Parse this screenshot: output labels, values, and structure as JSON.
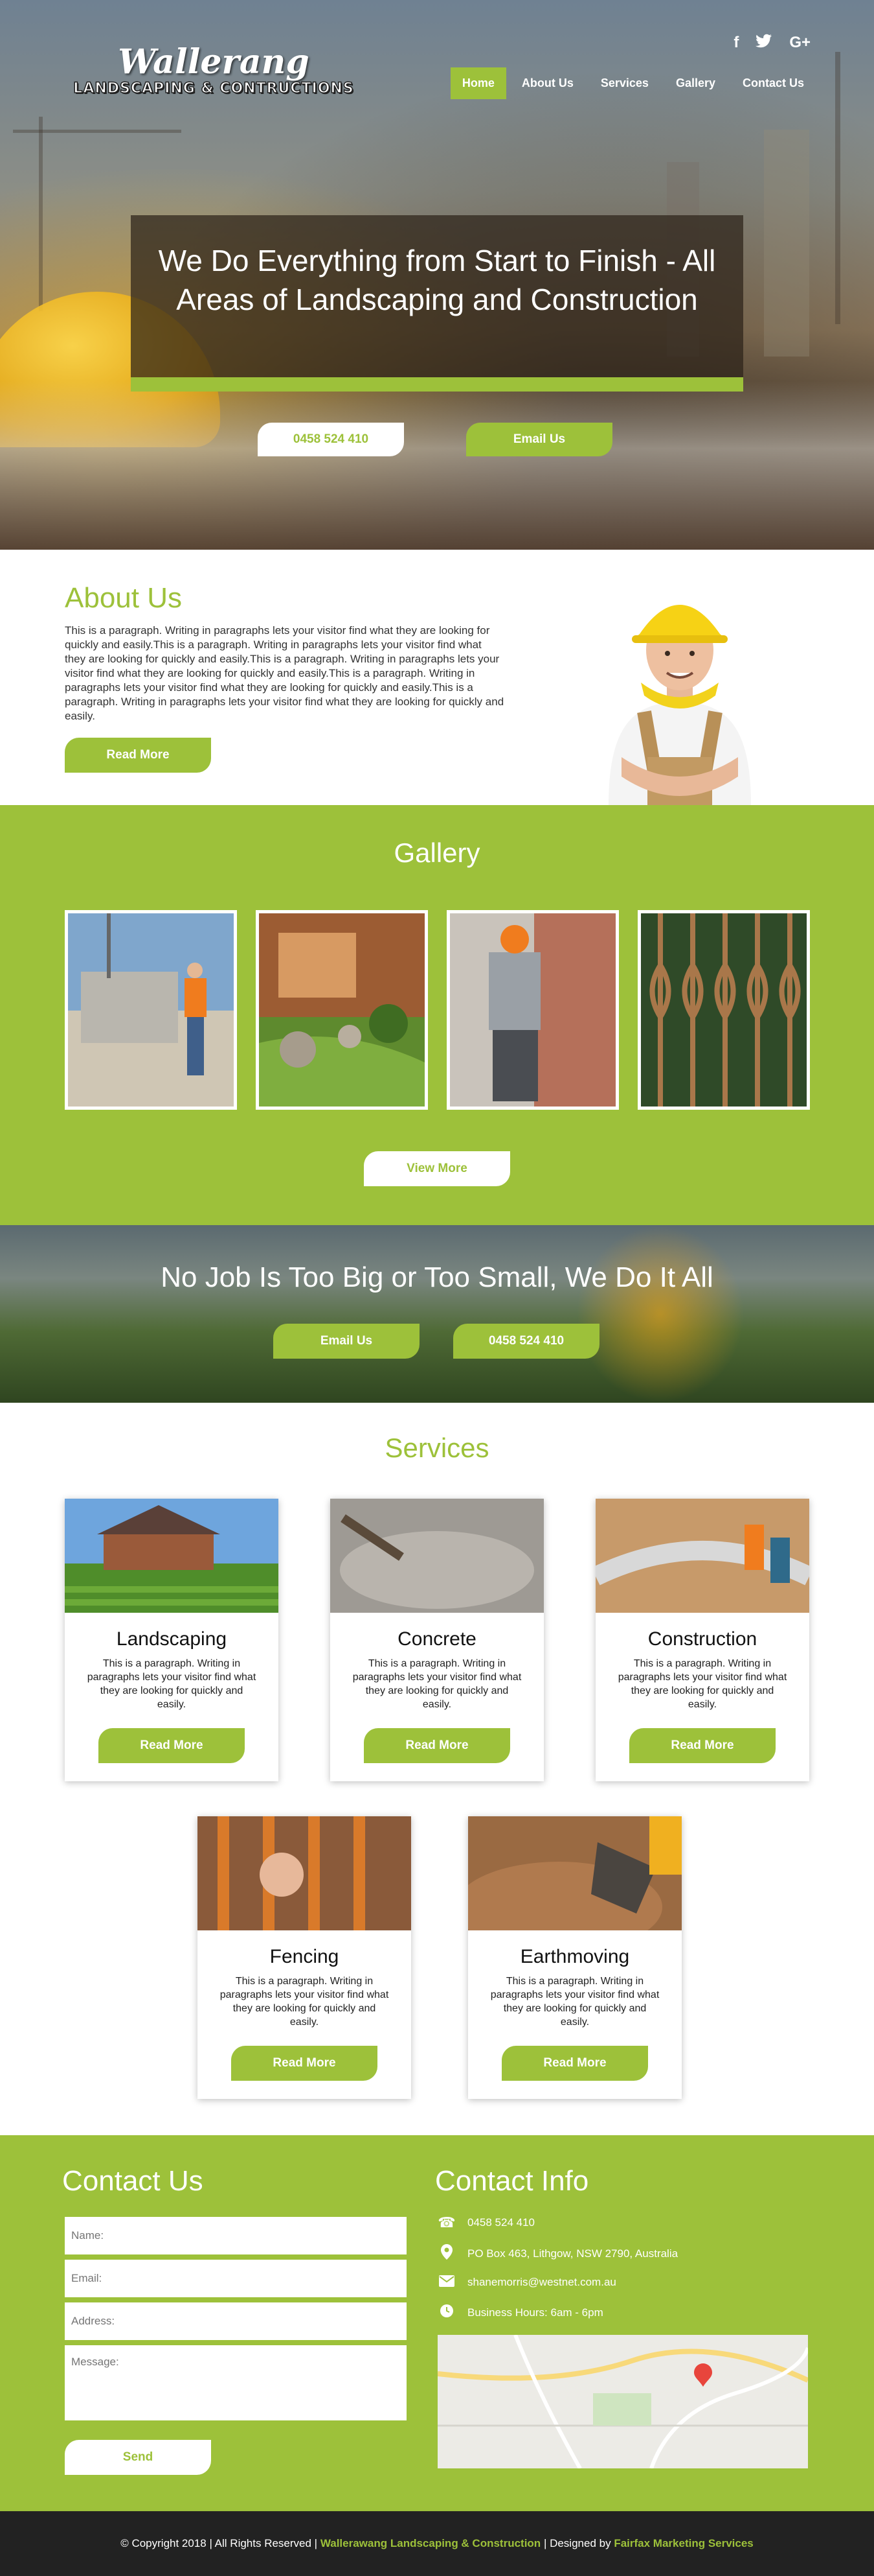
{
  "brand": {
    "script": "Wallerang",
    "sub": "LANDSCAPING & CONTRUCTIONS"
  },
  "social": {
    "facebook": "f",
    "twitter": "t",
    "google": "G+"
  },
  "nav": [
    "Home",
    "About Us",
    "Services",
    "Gallery",
    "Contact Us"
  ],
  "hero": {
    "headline": "We Do Everything from Start to Finish - All Areas of Landscaping and Construction",
    "phone_button": "0458 524 410",
    "email_button": "Email Us"
  },
  "about": {
    "title": "About Us",
    "paragraph": "This is a paragraph. Writing in paragraphs lets your visitor find what they are looking for quickly and easily.This is a paragraph. Writing in paragraphs lets your visitor find what they are looking for quickly and easily.This is a paragraph. Writing in paragraphs lets your visitor find what they are looking for quickly and easily.This is a paragraph. Writing in paragraphs lets your visitor find what they are looking for quickly and easily.This is a paragraph. Writing in paragraphs lets your visitor find what they are looking for quickly and easily.",
    "button": "Read More"
  },
  "gallery": {
    "title": "Gallery",
    "button": "View More"
  },
  "cta": {
    "headline": "No Job Is Too Big or Too Small, We Do It All",
    "email_button": "Email Us",
    "phone_button": "0458 524 410"
  },
  "services": {
    "title": "Services",
    "items": [
      {
        "name": "Landscaping",
        "text": "This is a paragraph. Writing in paragraphs lets your visitor find what they are looking for quickly and easily.",
        "button": "Read More"
      },
      {
        "name": "Concrete",
        "text": "This is a paragraph. Writing in paragraphs lets your visitor find what they are looking for quickly and easily.",
        "button": "Read More"
      },
      {
        "name": "Construction",
        "text": "This is a paragraph. Writing in paragraphs lets your visitor find what they are looking for quickly and easily.",
        "button": "Read More"
      },
      {
        "name": "Fencing",
        "text": "This is a paragraph. Writing in paragraphs lets your visitor find what they are looking for quickly and easily.",
        "button": "Read More"
      },
      {
        "name": "Earthmoving",
        "text": "This is a paragraph. Writing in paragraphs lets your visitor find what they are looking for quickly and easily.",
        "button": "Read More"
      }
    ]
  },
  "contact": {
    "title": "Contact Us",
    "placeholders": {
      "name": "Name:",
      "email": "Email:",
      "address": "Address:",
      "message": "Message:"
    },
    "send": "Send"
  },
  "contact_info": {
    "title": "Contact Info",
    "phone": "0458 524 410",
    "address": "PO Box 463, Lithgow, NSW 2790, Australia",
    "email": "shanemorris@westnet.com.au",
    "hours": "Business Hours: 6am - 6pm"
  },
  "footer": {
    "prefix": "© Copyright 2018 | All Rights Reserved |",
    "company": "Wallerawang Landscaping & Construction",
    "middle": "| Designed by",
    "designer": "Fairfax Marketing Services"
  },
  "colors": {
    "accent": "#9dc13a",
    "dark": "#222222"
  }
}
